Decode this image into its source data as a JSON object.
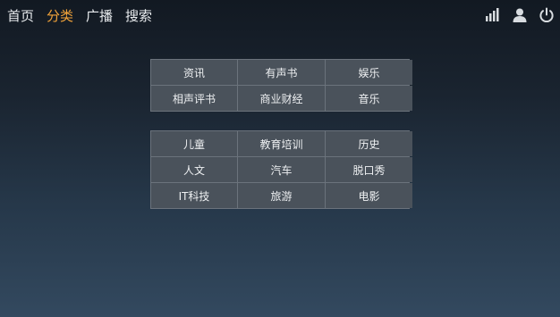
{
  "nav": {
    "items": [
      {
        "label": "首页",
        "active": false
      },
      {
        "label": "分类",
        "active": true
      },
      {
        "label": "广播",
        "active": false
      },
      {
        "label": "搜索",
        "active": false
      }
    ],
    "active_color": "#f2a33a"
  },
  "status": {
    "icons": [
      "signal-icon",
      "user-icon",
      "power-icon"
    ]
  },
  "categories": {
    "group1": [
      "资讯",
      "有声书",
      "娱乐",
      "相声评书",
      "商业财经",
      "音乐"
    ],
    "group2": [
      "儿童",
      "教育培训",
      "历史",
      "人文",
      "汽车",
      "脱口秀",
      "IT科技",
      "旅游",
      "电影"
    ]
  }
}
